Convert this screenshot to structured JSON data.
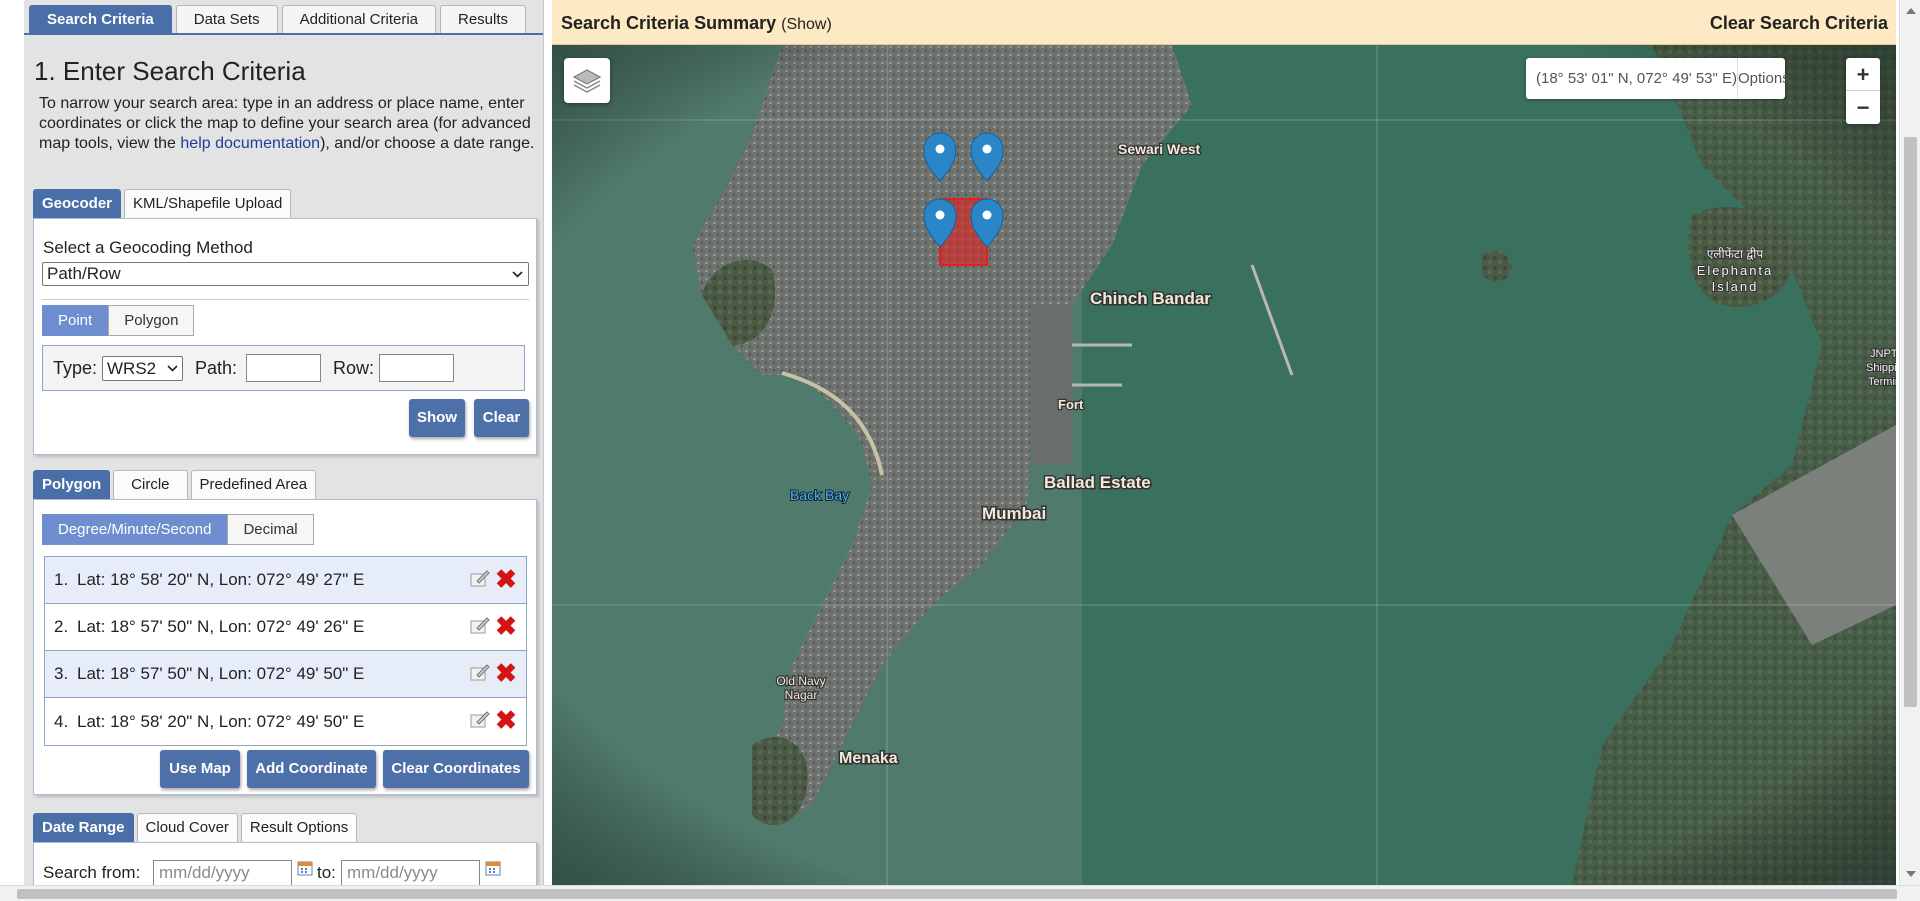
{
  "main_tabs": [
    "Search Criteria",
    "Data Sets",
    "Additional Criteria",
    "Results"
  ],
  "title": "1. Enter Search Criteria",
  "intro": {
    "text_before": "To narrow your search area: type in an address or place name, enter coordinates or click the map to define your search area (for advanced map tools, view the ",
    "link": "help documentation",
    "text_after": "), and/or choose a date range."
  },
  "geocoder": {
    "tabs": [
      "Geocoder",
      "KML/Shapefile Upload"
    ],
    "method_label": "Select a Geocoding Method",
    "method_value": "Path/Row",
    "toggle": [
      "Point",
      "Polygon"
    ],
    "type_label": "Type:",
    "type_value": "WRS2",
    "path_label": "Path:",
    "row_label": "Row:",
    "show_label": "Show",
    "clear_label": "Clear"
  },
  "area": {
    "tabs": [
      "Polygon",
      "Circle",
      "Predefined Area"
    ],
    "format_toggle": [
      "Degree/Minute/Second",
      "Decimal"
    ],
    "coordinates": [
      {
        "num": "1.",
        "text": "Lat: 18° 58' 20\" N, Lon: 072° 49' 27\" E"
      },
      {
        "num": "2.",
        "text": "Lat: 18° 57' 50\" N, Lon: 072° 49' 26\" E"
      },
      {
        "num": "3.",
        "text": "Lat: 18° 57' 50\" N, Lon: 072° 49' 50\" E"
      },
      {
        "num": "4.",
        "text": "Lat: 18° 58' 20\" N, Lon: 072° 49' 50\" E"
      }
    ],
    "use_map_label": "Use Map",
    "add_coord_label": "Add Coordinate",
    "clear_coords_label": "Clear Coordinates"
  },
  "date": {
    "tabs": [
      "Date Range",
      "Cloud Cover",
      "Result Options"
    ],
    "from_label": "Search from:",
    "to_label": "to:",
    "placeholder": "mm/dd/yyyy"
  },
  "summary": {
    "title": "Search Criteria Summary",
    "show": "(Show)",
    "clear": "Clear Search Criteria"
  },
  "map": {
    "cursor_coords": "(18° 53' 01\" N, 072° 49' 53\" E)",
    "options_label": "Options",
    "zoom_in": "+",
    "zoom_out": "−",
    "labels": {
      "sewari": "Sewari West",
      "chinch": "Chinch Bandar",
      "elephanta": [
        "एलीफेंटा द्वीप",
        "Elephanta",
        "Island"
      ],
      "jnpt": [
        "JNPT",
        "Shipping",
        "Terminal"
      ],
      "fort": "Fort",
      "ballad": "Ballad Estate",
      "backbay": "Back Bay",
      "mumbai": "Mumbai",
      "oldnavy": [
        "Old Navy",
        "Nagar"
      ],
      "menaka": "Menaka"
    }
  },
  "colors": {
    "accent": "#4a6ea8",
    "summary_bg": "#fde9c4",
    "pin": "#2a85c9",
    "aoi": "#e02020",
    "delete": "#d41313"
  }
}
